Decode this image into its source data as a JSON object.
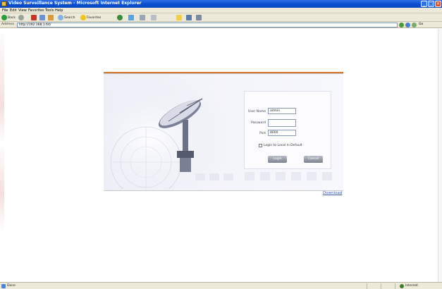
{
  "window": {
    "title": "Video Surveillance System - Microsoft Internet Explorer",
    "minimize": "_",
    "maximize": "□",
    "close": "×"
  },
  "menubar": {
    "items": [
      "File",
      "Edit",
      "View",
      "Favorites",
      "Tools",
      "Help"
    ]
  },
  "toolbar": {
    "back": "Back",
    "search": "Search",
    "favorites": "Favorites"
  },
  "addressbar": {
    "label": "Address",
    "url": "http://192.168.1.64/",
    "go": "Go"
  },
  "login": {
    "username_label": "User Name",
    "username_value": "admin",
    "password_label": "Password",
    "password_value": "",
    "port_label": "Port",
    "port_value": "8000",
    "remember_label": "Login to Local in Default",
    "login_button": "Login",
    "cancel_button": "Cancel"
  },
  "download_link": "Download",
  "statusbar": {
    "status_text": "Done",
    "zone_text": "Internet"
  },
  "colors": {
    "panel_accent": "#d7782c",
    "title_bar": "#0a4fd0",
    "link": "#3a56a8"
  }
}
